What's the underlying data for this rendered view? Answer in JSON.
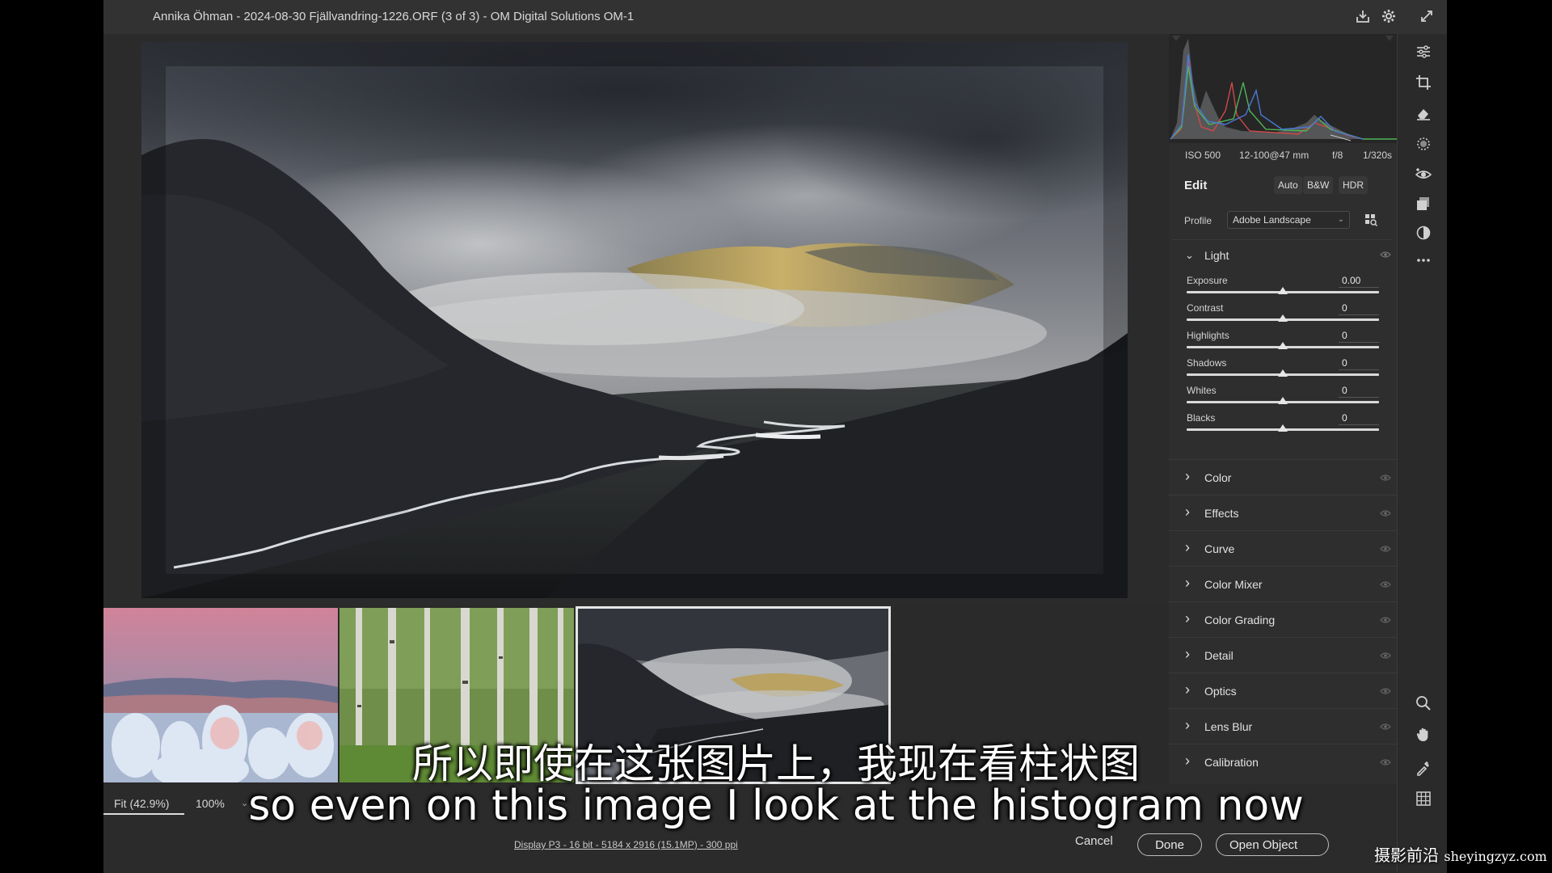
{
  "window": {
    "title": "Annika Öhman - 2024-08-30 Fjällvandring-1226.ORF (3 of 3)  -  OM Digital Solutions OM-1"
  },
  "exif": {
    "iso": "ISO 500",
    "lens": "12-100@47 mm",
    "aperture": "f/8",
    "shutter": "1/320s"
  },
  "edit": {
    "title": "Edit",
    "buttons": [
      "Auto",
      "B&W",
      "HDR"
    ],
    "profile_label": "Profile",
    "profile_value": "Adobe Landscape"
  },
  "light": {
    "label": "Light",
    "sliders": [
      {
        "label": "Exposure",
        "value": "0.00",
        "position": 0.5
      },
      {
        "label": "Contrast",
        "value": "0",
        "position": 0.5
      },
      {
        "label": "Highlights",
        "value": "0",
        "position": 0.5
      },
      {
        "label": "Shadows",
        "value": "0",
        "position": 0.5
      },
      {
        "label": "Whites",
        "value": "0",
        "position": 0.5
      },
      {
        "label": "Blacks",
        "value": "0",
        "position": 0.5
      }
    ]
  },
  "sections": [
    "Color",
    "Effects",
    "Curve",
    "Color Mixer",
    "Color Grading",
    "Detail",
    "Optics",
    "Lens Blur",
    "Calibration"
  ],
  "bottom": {
    "zoom_fit": "Fit (42.9%)",
    "zoom_100": "100%",
    "file_info": "Display P3 - 16 bit - 5184 x 2916 (15.1MP) - 300 ppi",
    "cancel": "Cancel",
    "done": "Done",
    "open": "Open Object"
  },
  "subtitles": {
    "zh": "所以即使在这张图片上，我现在看柱状图",
    "en": "so even on this image I look at the histogram now"
  },
  "watermark": {
    "zh": "摄影前沿",
    "url": "sheyingzyz.com"
  },
  "icons": {
    "titlebar": [
      "save-icon",
      "settings-gear-icon",
      "expand-icon"
    ],
    "tools": [
      "edit-sliders-icon",
      "crop-icon",
      "heal-eraser-icon",
      "mask-icon",
      "red-eye-icon",
      "presets-icon",
      "snapshots-icon",
      "more-icon",
      "zoom-icon",
      "hand-icon",
      "color-sampler-icon",
      "grid-icon"
    ]
  },
  "colors": {
    "panel": "#2e2e2e",
    "background": "#2b2b2b",
    "accent": "#e6e6e6"
  }
}
